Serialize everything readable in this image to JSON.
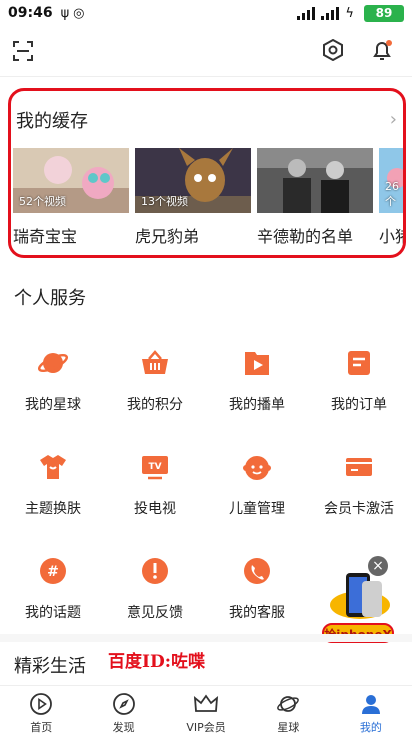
{
  "status_bar": {
    "time": "09:46",
    "battery": "89"
  },
  "cache": {
    "title": "我的缓存",
    "items": [
      {
        "label": "瑞奇宝宝",
        "count": "52个视频"
      },
      {
        "label": "虎兄豹弟",
        "count": "13个视频"
      },
      {
        "label": "辛德勒的名单",
        "count": ""
      },
      {
        "label": "小猪",
        "count": "26个"
      }
    ]
  },
  "services": {
    "title": "个人服务",
    "items": [
      {
        "label": "我的星球",
        "icon": "planet-icon"
      },
      {
        "label": "我的积分",
        "icon": "basket-icon"
      },
      {
        "label": "我的播单",
        "icon": "playlist-icon"
      },
      {
        "label": "我的订单",
        "icon": "order-icon"
      },
      {
        "label": "主题换肤",
        "icon": "tshirt-icon"
      },
      {
        "label": "投电视",
        "icon": "tv-icon"
      },
      {
        "label": "儿童管理",
        "icon": "child-face-icon"
      },
      {
        "label": "会员卡激活",
        "icon": "card-icon"
      },
      {
        "label": "我的话题",
        "icon": "hashtag-icon"
      },
      {
        "label": "意见反馈",
        "icon": "exclamation-icon"
      },
      {
        "label": "我的客服",
        "icon": "phone-icon"
      }
    ]
  },
  "life": {
    "title": "精彩生活"
  },
  "watermark": "百度ID:咗喋",
  "promo": {
    "label": "抢iphoneX"
  },
  "tabs": [
    {
      "label": "首页",
      "icon": "play-circle-icon"
    },
    {
      "label": "发现",
      "icon": "compass-icon"
    },
    {
      "label": "VIP会员",
      "icon": "crown-icon"
    },
    {
      "label": "星球",
      "icon": "planet-outline-icon"
    },
    {
      "label": "我的",
      "icon": "profile-icon",
      "active": true
    }
  ],
  "colors": {
    "accent": "#f26b3a",
    "highlight": "#e3101c",
    "active_tab": "#2a6fd6",
    "battery": "#2bb24c"
  }
}
